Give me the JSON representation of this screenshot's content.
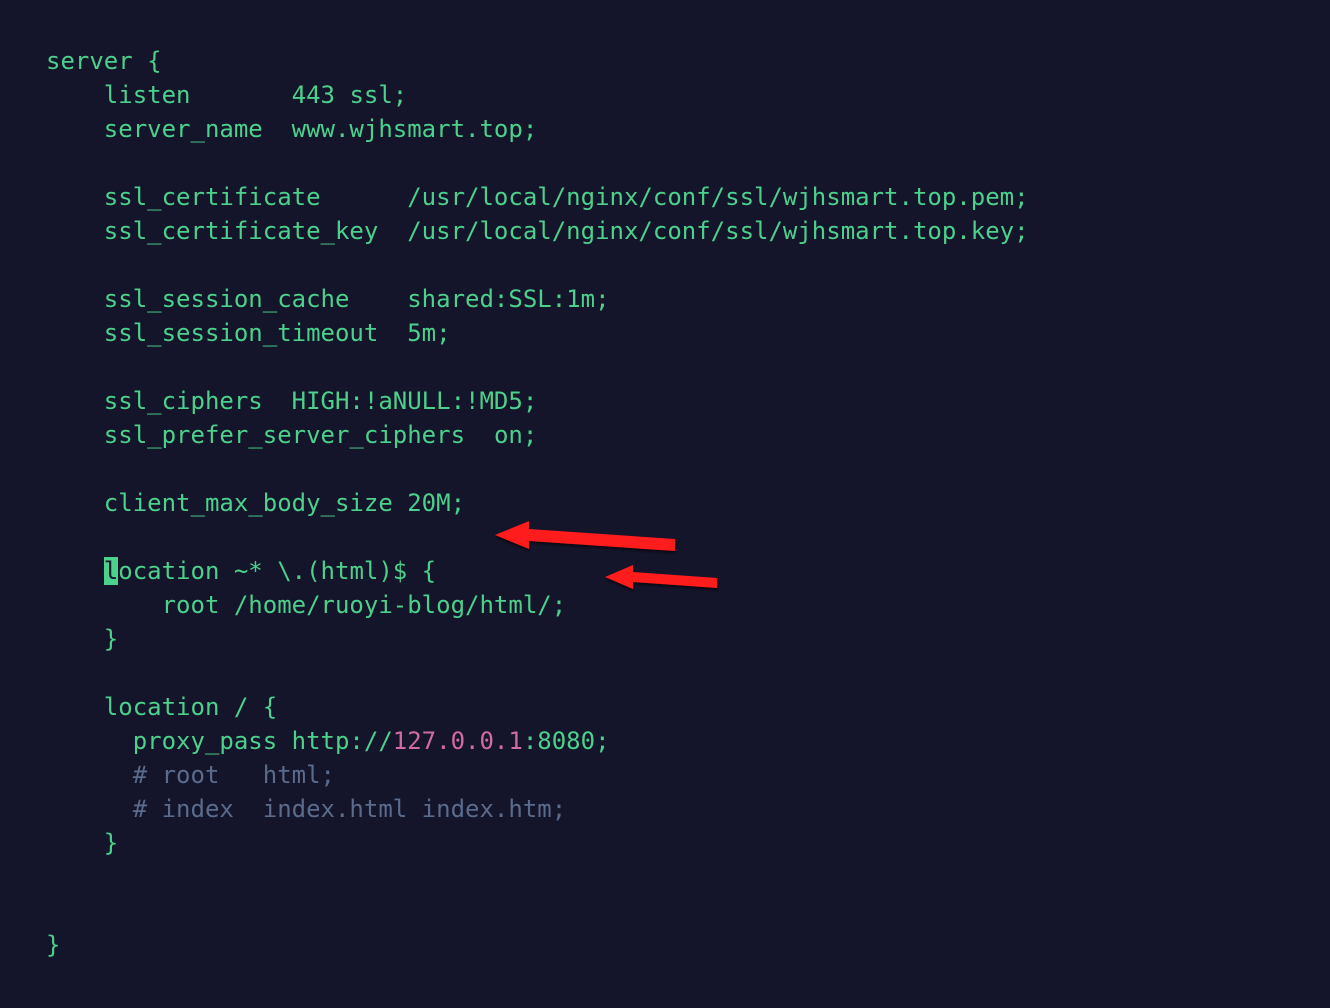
{
  "code": {
    "l1": "server {",
    "l2a": "    listen       ",
    "l2b": "443",
    "l2c": " ssl;",
    "l3a": "    server_name  www.wjhsmart.top;",
    "l4": "",
    "l5a": "    ssl_certificate      /usr/local/nginx/conf/ssl/wjhsmart.top.pem;",
    "l6a": "    ssl_certificate_key  /usr/local/nginx/conf/ssl/wjhsmart.top.key;",
    "l7": "",
    "l8": "    ssl_session_cache    shared:SSL:",
    "l8b": "1m",
    "l8c": ";",
    "l9": "    ssl_session_timeout  ",
    "l9b": "5m",
    "l9c": ";",
    "l10": "",
    "l11": "    ssl_ciphers  HIGH:!aNULL:!MD5;",
    "l12": "    ssl_prefer_server_ciphers  ",
    "l12b": "on",
    "l12c": ";",
    "l13": "",
    "l14": "    client_max_body_size 20M;",
    "l15": "",
    "l16a": "    ",
    "l16cur": "l",
    "l16b": "ocation ~* \\.(html)$ {",
    "l17": "        root /home/ruoyi-blog/html/;",
    "l18": "    }",
    "l19": "",
    "l20": "    location / {",
    "l21a": "      proxy_pass http://",
    "l21b": "127.0.0.1",
    "l21c": ":",
    "l21d": "8080",
    "l21e": ";",
    "l22": "      # root   html;",
    "l23": "      # index  index.html index.htm;",
    "l24": "    }",
    "l25": "",
    "l26": "",
    "l27": "}"
  },
  "annotations": {
    "arrow1_target": "location ~* \\.(html)$ {",
    "arrow2_target": "root /home/ruoyi-blog/html/;"
  }
}
